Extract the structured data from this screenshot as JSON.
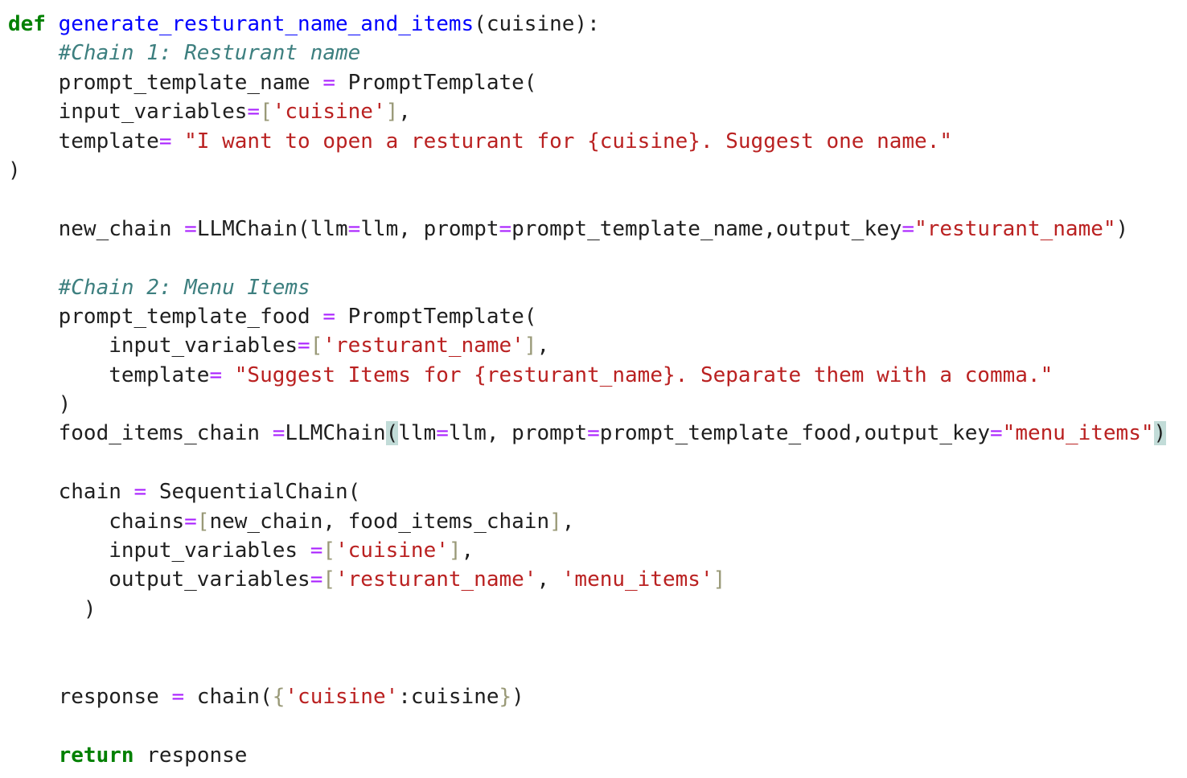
{
  "code": {
    "language": "python",
    "lines": [
      [
        [
          "kw",
          "def"
        ],
        [
          "p",
          " "
        ],
        [
          "fn",
          "generate_resturant_name_and_items"
        ],
        [
          "p",
          "(cuisine):"
        ]
      ],
      [
        [
          "p",
          "    "
        ],
        [
          "cm",
          "#Chain 1: Resturant name"
        ]
      ],
      [
        [
          "p",
          "    prompt_template_name "
        ],
        [
          "op",
          "="
        ],
        [
          "p",
          " PromptTemplate("
        ]
      ],
      [
        [
          "p",
          "    input_variables"
        ],
        [
          "op",
          "="
        ],
        [
          "br",
          "["
        ],
        [
          "str",
          "'cuisine'"
        ],
        [
          "br",
          "]"
        ],
        [
          "p",
          ","
        ]
      ],
      [
        [
          "p",
          "    template"
        ],
        [
          "op",
          "="
        ],
        [
          "p",
          " "
        ],
        [
          "str",
          "\"I want to open a resturant for {cuisine}. Suggest one name.\""
        ]
      ],
      [
        [
          "p",
          ")"
        ]
      ],
      [],
      [
        [
          "p",
          "    new_chain "
        ],
        [
          "op",
          "="
        ],
        [
          "p",
          "LLMChain(llm"
        ],
        [
          "op",
          "="
        ],
        [
          "p",
          "llm, prompt"
        ],
        [
          "op",
          "="
        ],
        [
          "p",
          "prompt_template_name,output_key"
        ],
        [
          "op",
          "="
        ],
        [
          "str",
          "\"resturant_name\""
        ],
        [
          "p",
          ")"
        ]
      ],
      [],
      [
        [
          "p",
          "    "
        ],
        [
          "cm",
          "#Chain 2: Menu Items"
        ]
      ],
      [
        [
          "p",
          "    prompt_template_food "
        ],
        [
          "op",
          "="
        ],
        [
          "p",
          " PromptTemplate("
        ]
      ],
      [
        [
          "p",
          "        input_variables"
        ],
        [
          "op",
          "="
        ],
        [
          "br",
          "["
        ],
        [
          "str",
          "'resturant_name'"
        ],
        [
          "br",
          "]"
        ],
        [
          "p",
          ","
        ]
      ],
      [
        [
          "p",
          "        template"
        ],
        [
          "op",
          "="
        ],
        [
          "p",
          " "
        ],
        [
          "str",
          "\"Suggest Items for {resturant_name}. Separate them with a comma.\""
        ]
      ],
      [
        [
          "p",
          "    )"
        ]
      ],
      [
        [
          "p",
          "    food_items_chain "
        ],
        [
          "op",
          "="
        ],
        [
          "p",
          "LLMChain"
        ],
        [
          "match",
          "("
        ],
        [
          "p",
          "llm"
        ],
        [
          "op",
          "="
        ],
        [
          "p",
          "llm, prompt"
        ],
        [
          "op",
          "="
        ],
        [
          "p",
          "prompt_template_food,output_key"
        ],
        [
          "op",
          "="
        ],
        [
          "str",
          "\"menu_items\""
        ],
        [
          "match",
          ")"
        ]
      ],
      [],
      [
        [
          "p",
          "    chain "
        ],
        [
          "op",
          "="
        ],
        [
          "p",
          " SequentialChain("
        ]
      ],
      [
        [
          "p",
          "        chains"
        ],
        [
          "op",
          "="
        ],
        [
          "br",
          "["
        ],
        [
          "p",
          "new_chain, food_items_chain"
        ],
        [
          "br",
          "]"
        ],
        [
          "p",
          ","
        ]
      ],
      [
        [
          "p",
          "        input_variables "
        ],
        [
          "op",
          "="
        ],
        [
          "br",
          "["
        ],
        [
          "str",
          "'cuisine'"
        ],
        [
          "br",
          "]"
        ],
        [
          "p",
          ","
        ]
      ],
      [
        [
          "p",
          "        output_variables"
        ],
        [
          "op",
          "="
        ],
        [
          "br",
          "["
        ],
        [
          "str",
          "'resturant_name'"
        ],
        [
          "p",
          ", "
        ],
        [
          "str",
          "'menu_items'"
        ],
        [
          "br",
          "]"
        ]
      ],
      [
        [
          "p",
          "      )"
        ]
      ],
      [],
      [],
      [
        [
          "p",
          "    response "
        ],
        [
          "op",
          "="
        ],
        [
          "p",
          " chain("
        ],
        [
          "br",
          "{"
        ],
        [
          "str",
          "'cuisine'"
        ],
        [
          "p",
          ":cuisine"
        ],
        [
          "br",
          "}"
        ],
        [
          "p",
          ")"
        ]
      ],
      [],
      [
        [
          "p",
          "    "
        ],
        [
          "kw",
          "return"
        ],
        [
          "p",
          " response"
        ]
      ]
    ]
  }
}
